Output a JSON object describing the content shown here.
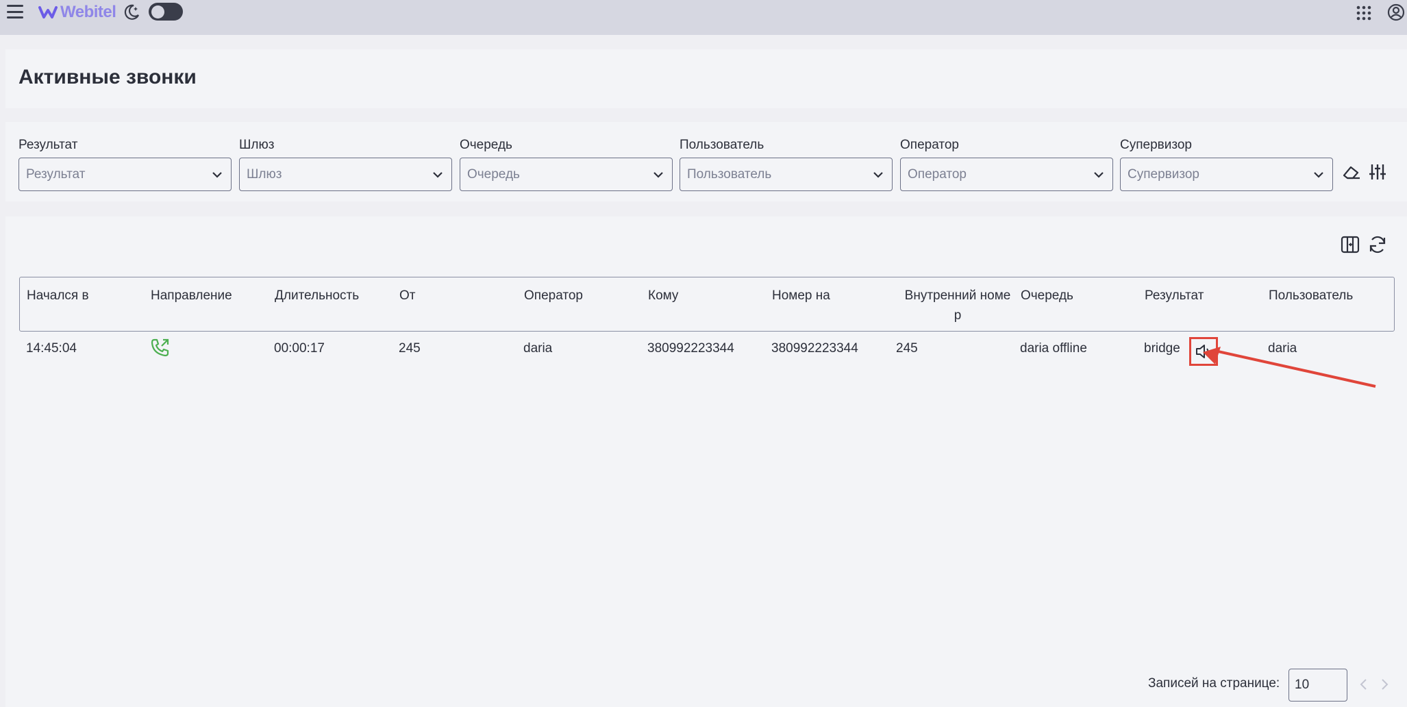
{
  "header": {
    "brand": "Webitel",
    "icons": [
      "menu-icon",
      "moon-icon",
      "apps-grid-icon",
      "profile-icon"
    ],
    "theme_toggle": "off"
  },
  "page": {
    "title": "Активные звонки"
  },
  "filters": [
    {
      "label": "Результат",
      "placeholder": "Результат"
    },
    {
      "label": "Шлюз",
      "placeholder": "Шлюз"
    },
    {
      "label": "Очередь",
      "placeholder": "Очередь"
    },
    {
      "label": "Пользователь",
      "placeholder": "Пользователь"
    },
    {
      "label": "Оператор",
      "placeholder": "Оператор"
    },
    {
      "label": "Супервизор",
      "placeholder": "Супервизор"
    }
  ],
  "table": {
    "columns": [
      "Начался в",
      "Направление",
      "Длительность",
      "От",
      "Оператор",
      "Кому",
      "Номер на",
      "Внутренний номе р",
      "Очередь",
      "Результат",
      "Пользователь"
    ],
    "rows": [
      {
        "started": "14:45:04",
        "direction_icon": "outbound-call-icon",
        "duration": "00:00:17",
        "from": "245",
        "operator": "daria",
        "to": "380992223344",
        "number": "380992223344",
        "extension": "245",
        "queue": "daria offline",
        "result": "bridge",
        "user": "daria"
      }
    ]
  },
  "pagination": {
    "label": "Записей на странице:",
    "per_page": "10"
  },
  "colors": {
    "accent": "#8f86e8",
    "call_icon": "#4caf50",
    "annotation": "#e0453a",
    "topbar": "#d6d7e1"
  }
}
